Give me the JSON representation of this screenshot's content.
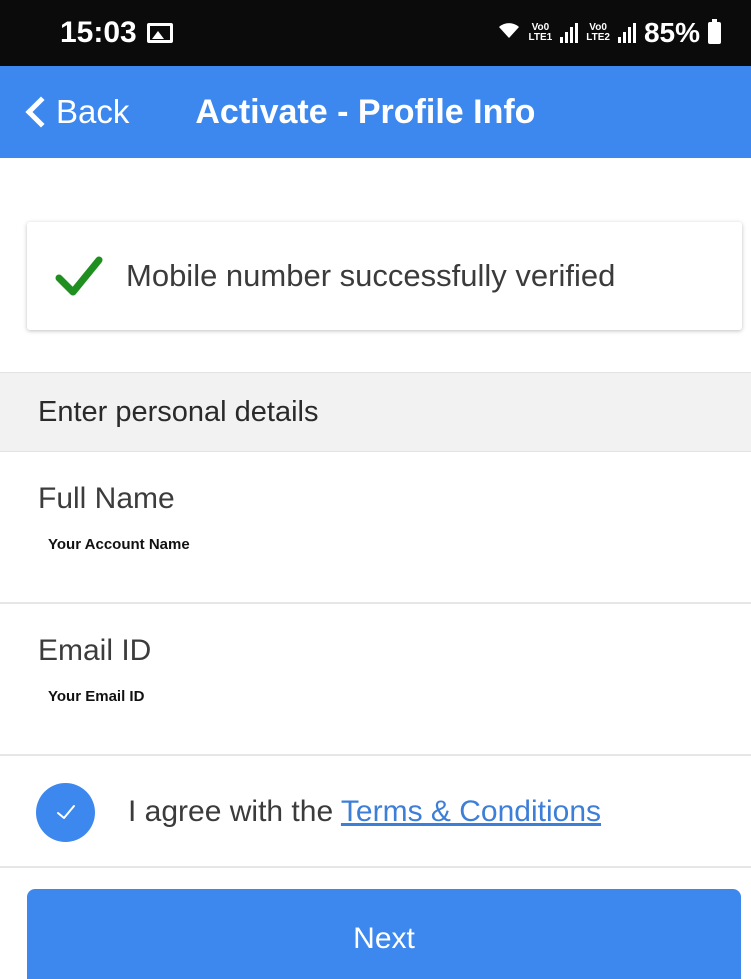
{
  "status_bar": {
    "time": "15:03",
    "battery": "85%",
    "network_top": "Vo0",
    "network_lte1": "LTE1",
    "network_lte2": "LTE2"
  },
  "nav": {
    "back_label": "Back",
    "title": "Activate - Profile Info"
  },
  "verification": {
    "message": "Mobile number successfully verified",
    "icon": "check-icon",
    "icon_color": "#1f8f1f"
  },
  "section": {
    "title": "Enter personal details"
  },
  "fields": {
    "full_name": {
      "label": "Full Name",
      "value": "Your Account Name"
    },
    "email": {
      "label": "Email ID",
      "value": "Your Email ID"
    }
  },
  "agree": {
    "text": "I agree with the",
    "link": "Terms & Conditions",
    "checked": true
  },
  "actions": {
    "next_label": "Next"
  },
  "colors": {
    "accent": "#3d88ee",
    "status_bar": "#0b0b0b",
    "link": "#3d7fd8"
  }
}
